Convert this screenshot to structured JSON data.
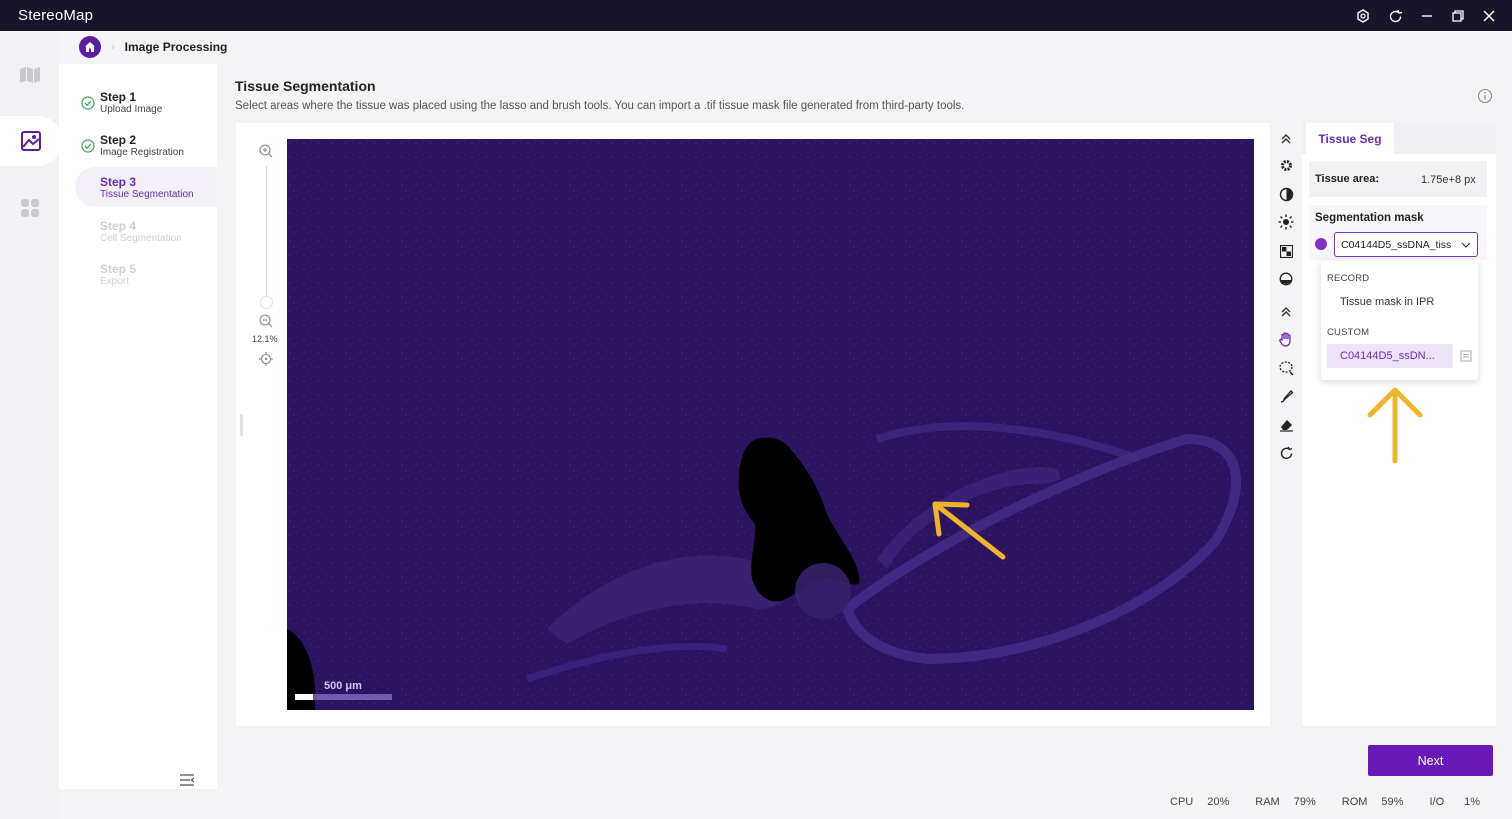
{
  "app": {
    "title": "StereoMap"
  },
  "breadcrumb": {
    "label": "Image Processing"
  },
  "steps": [
    {
      "title": "Step 1",
      "subtitle": "Upload Image",
      "state": "done"
    },
    {
      "title": "Step 2",
      "subtitle": "Image Registration",
      "state": "done"
    },
    {
      "title": "Step 3",
      "subtitle": "Tissue Segmentation",
      "state": "active"
    },
    {
      "title": "Step 4",
      "subtitle": "Cell Segmentation",
      "state": "disabled"
    },
    {
      "title": "Step 5",
      "subtitle": "Export",
      "state": "disabled"
    }
  ],
  "page": {
    "title": "Tissue Segmentation",
    "description": "Select areas where the tissue was placed using the lasso and brush tools. You can import a .tif tissue mask file generated from third-party tools."
  },
  "viewer": {
    "zoom_level": "12.1%",
    "scale_bar": "500 μm"
  },
  "panel": {
    "tab": "Tissue Seg",
    "tissue_area_label": "Tissue area:",
    "tissue_area_value": "1.75e+8 px",
    "mask_label": "Segmentation mask",
    "mask_selected": "C04144D5_ssDNA_tiss",
    "dropdown": {
      "record_group": "RECORD",
      "record_item": "Tissue mask in IPR",
      "custom_group": "CUSTOM",
      "custom_item": "C04144D5_ssDN..."
    }
  },
  "actions": {
    "next": "Next"
  },
  "status": {
    "cpu_label": "CPU",
    "cpu_value": "20%",
    "ram_label": "RAM",
    "ram_value": "79%",
    "rom_label": "ROM",
    "rom_value": "59%",
    "io_label": "I/O",
    "io_value": "1%"
  },
  "colors": {
    "accent": "#6a18b8",
    "titlebar": "#17142b",
    "tissue": "#2a1460",
    "annotation_arrow": "#f0b429"
  }
}
